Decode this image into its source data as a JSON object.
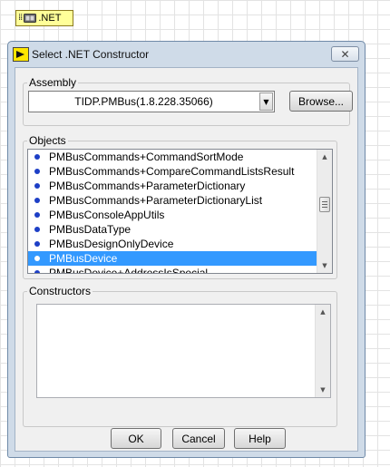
{
  "node": {
    "terminal_glyph": "⁞⁞",
    "label": ".NET",
    "icon": "dotnet-object-icon"
  },
  "dialog": {
    "title": "Select .NET Constructor",
    "close_glyph": "✕",
    "assembly": {
      "label": "Assembly",
      "value": "TIDP.PMBus(1.8.228.35066)",
      "dropdown_glyph": "▼",
      "browse_label": "Browse..."
    },
    "objects": {
      "label": "Objects",
      "selected_index": 7,
      "items": [
        "PMBusCommands+CommandSortMode",
        "PMBusCommands+CompareCommandListsResult",
        "PMBusCommands+ParameterDictionary",
        "PMBusCommands+ParameterDictionaryList",
        "PMBusConsoleAppUtils",
        "PMBusDataType",
        "PMBusDesignOnlyDevice",
        "PMBusDevice",
        "PMBusDevice+AddressIsSpecial"
      ]
    },
    "constructors": {
      "label": "Constructors",
      "items": []
    },
    "buttons": {
      "ok": "OK",
      "cancel": "Cancel",
      "help": "Help"
    }
  }
}
